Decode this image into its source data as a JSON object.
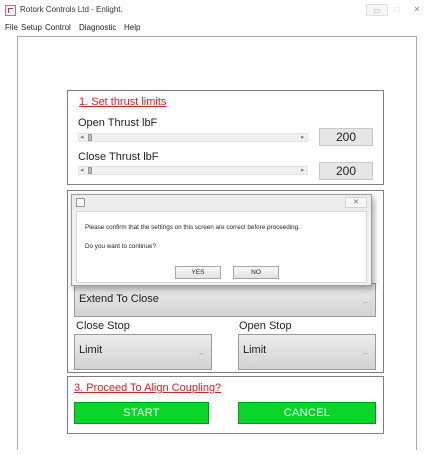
{
  "window": {
    "title": "Rotork Controls Ltd - Enlight.",
    "min_glyph": "▭",
    "max_glyph": "□",
    "close_glyph": "✕"
  },
  "menu": [
    "File",
    "Setup",
    "Control",
    "Diagnostic",
    "Help"
  ],
  "thrust": {
    "title": "1. Set thrust limits",
    "open_label": "Open  Thrust lbF",
    "open_value": "200",
    "close_label": "Close  Thrust lbF",
    "close_value": "200",
    "arrow_left": "◂",
    "arrow_right": "▸"
  },
  "params": {
    "direction_value": "Extend To Close",
    "close_stop_label": "Close Stop",
    "close_stop_value": "Limit",
    "open_stop_label": "Open Stop",
    "open_stop_value": "Limit",
    "dd_arrow": "⌐"
  },
  "proceed": {
    "title": "3. Proceed To Align Coupling?",
    "start_label": "START",
    "cancel_label": "CANCEL"
  },
  "dialog": {
    "message": "Please confirm that the settings on this screen are correct before proceeding.",
    "question": "Do you want to continue?",
    "yes_label": "YES",
    "no_label": "NO",
    "close_glyph": "✕"
  },
  "colors": {
    "accent_red": "#e31b23",
    "button_green": "#0ad629"
  }
}
